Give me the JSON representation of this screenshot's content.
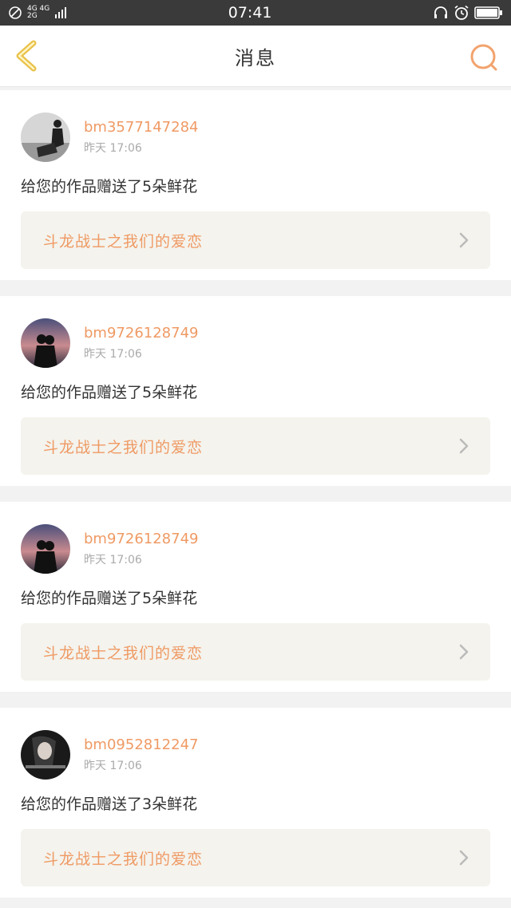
{
  "status_bar": {
    "network_1": "4G 4G",
    "network_2": "2G",
    "time": "07:41"
  },
  "header": {
    "title": "消息",
    "back_icon": "chevron-left-icon",
    "search_icon": "search-icon"
  },
  "colors": {
    "accent": "#ef9a64",
    "card_link_bg": "#f4f3ed",
    "page_bg": "#f2f2f2"
  },
  "messages": [
    {
      "username": "bm3577147284",
      "time": "昨天 17:06",
      "text": "给您的作品赠送了5朵鲜花",
      "work_title": "斗龙战士之我们的爱恋"
    },
    {
      "username": "bm9726128749",
      "time": "昨天 17:06",
      "text": "给您的作品赠送了5朵鲜花",
      "work_title": "斗龙战士之我们的爱恋"
    },
    {
      "username": "bm9726128749",
      "time": "昨天 17:06",
      "text": "给您的作品赠送了5朵鲜花",
      "work_title": "斗龙战士之我们的爱恋"
    },
    {
      "username": "bm0952812247",
      "time": "昨天 17:06",
      "text": "给您的作品赠送了3朵鲜花",
      "work_title": "斗龙战士之我们的爱恋"
    }
  ]
}
